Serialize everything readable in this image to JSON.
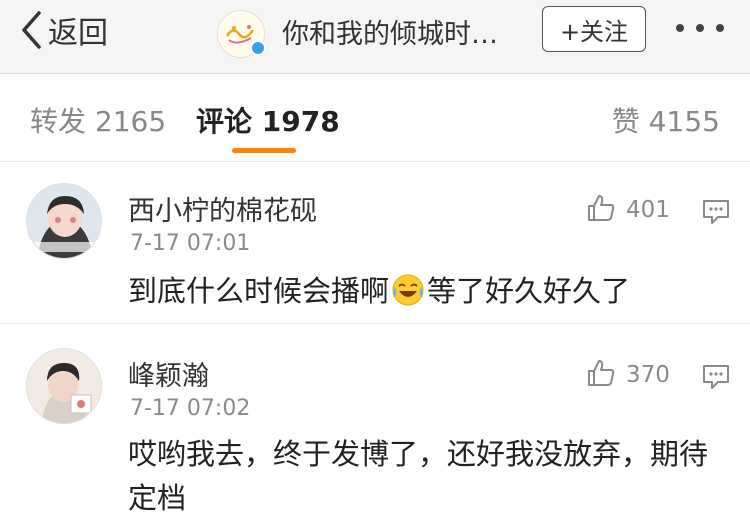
{
  "header": {
    "back_label": "返回",
    "title": "你和我的倾城时…",
    "follow_label": "+关注",
    "colors": {
      "bar_bg": "#f5f5f5",
      "accent": "#ff8200",
      "verified": "#3aa0e6"
    }
  },
  "tabs": [
    {
      "label": "转发 2165"
    },
    {
      "label": "评论 1978",
      "active": true
    },
    {
      "label": "赞 4155"
    }
  ],
  "comments": [
    {
      "username": "西小柠的棉花砚",
      "time": "7-17 07:01",
      "likes": "401",
      "text_before_emoji": "到底什么时候会播啊",
      "emoji": "laughing-crying-emoji",
      "text_after_emoji": "等了好久好久了"
    },
    {
      "username": "峰颖瀚",
      "time": "7-17 07:02",
      "likes": "370",
      "text": "哎哟我去，终于发博了，还好我没放弃，期待定档"
    }
  ],
  "icons": {
    "back": "chevron-left-icon",
    "more": "more-dots-icon",
    "like": "thumbs-up-icon",
    "reply": "comment-bubble-icon"
  }
}
